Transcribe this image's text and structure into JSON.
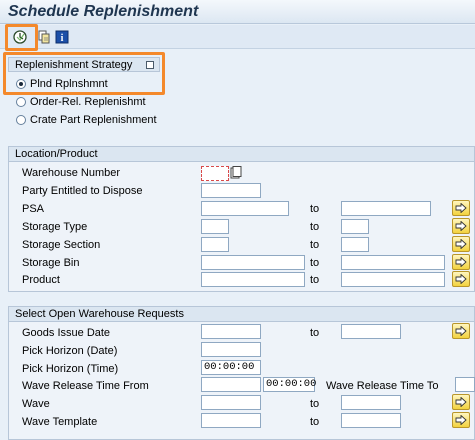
{
  "window": {
    "title": "Schedule Replenishment"
  },
  "toolbar": {
    "execute_icon": "clock-execute-icon",
    "variant_icon": "get-variant-icon",
    "info_icon": "info-icon",
    "info_glyph": "i"
  },
  "strategy": {
    "header": "Replenishment Strategy",
    "options": [
      {
        "label": "Plnd Rplnshmnt",
        "selected": true
      },
      {
        "label": "Order-Rel. Replenishmt",
        "selected": false
      },
      {
        "label": "Crate Part Replenishment",
        "selected": false
      }
    ]
  },
  "location": {
    "header": "Location/Product",
    "to_label": "to",
    "rows": [
      {
        "label": "Warehouse Number",
        "value": ""
      },
      {
        "label": "Party Entitled to Dispose",
        "value": ""
      },
      {
        "label": "PSA"
      },
      {
        "label": "Storage Type"
      },
      {
        "label": "Storage Section"
      },
      {
        "label": "Storage Bin"
      },
      {
        "label": "Product"
      }
    ]
  },
  "requests": {
    "header": "Select Open Warehouse Requests",
    "to_label": "to",
    "goods_issue_date": "Goods Issue Date",
    "pick_horizon_date": "Pick Horizon (Date)",
    "pick_horizon_time": "Pick Horizon (Time)",
    "pick_horizon_time_value": "00:00:00",
    "wave_release_from": "Wave Release Time From",
    "wave_release_from_time": "00:00:00",
    "wave_release_to": "Wave Release Time To",
    "wave": "Wave",
    "wave_template": "Wave Template"
  },
  "colors": {
    "highlight": "#f4892b",
    "select_button": "#f3d23e"
  }
}
